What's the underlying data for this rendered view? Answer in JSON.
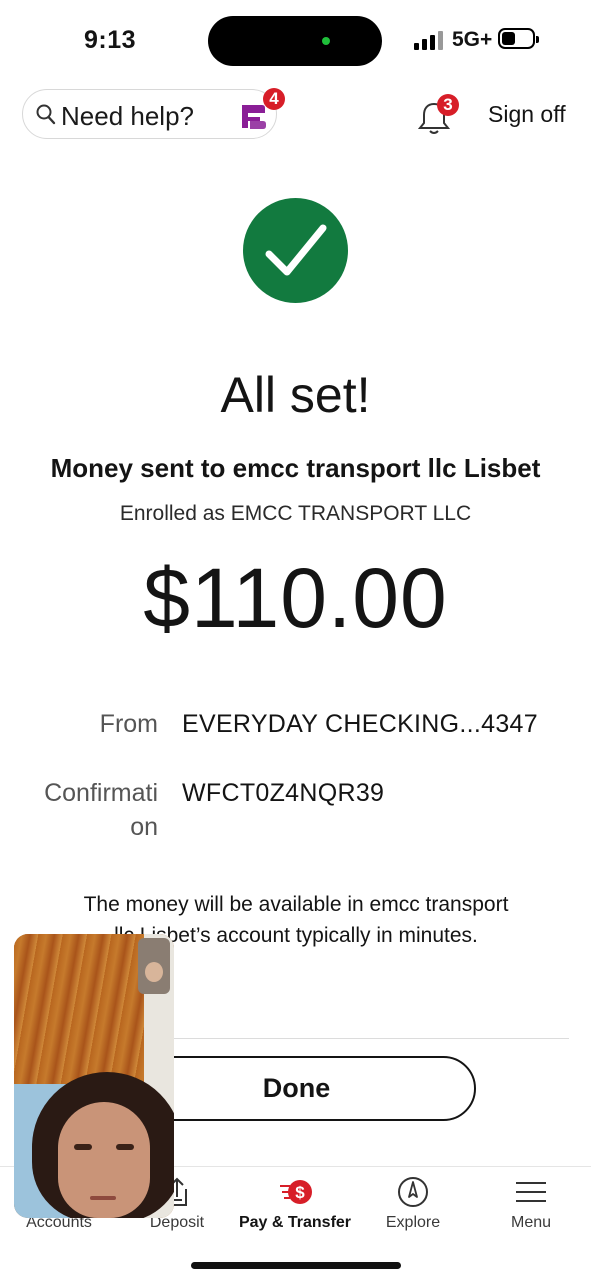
{
  "status_bar": {
    "time": "9:13",
    "network": "5G+"
  },
  "header": {
    "search_placeholder": "Need help?",
    "fargo_badge": "4",
    "notifications_badge": "3",
    "sign_off": "Sign off"
  },
  "confirmation": {
    "title": "All set!",
    "sent_to": "Money sent to emcc transport llc Lisbet",
    "enrolled_as": "Enrolled as EMCC TRANSPORT LLC",
    "amount": "$110.00",
    "from_label": "From",
    "from_value": "EVERYDAY CHECKING...4347",
    "confirmation_label_line1": "Confirmati",
    "confirmation_label_line2": "on",
    "confirmation_value": "WFCT0Z4NQR39",
    "message": "The money will be available in emcc transport llc Lisbet’s account typically in minutes.",
    "done_label": "Done"
  },
  "bottom_nav": {
    "items": [
      {
        "label": "Accounts",
        "icon": "accounts-icon"
      },
      {
        "label": "Deposit",
        "icon": "deposit-icon"
      },
      {
        "label": "Pay & Transfer",
        "icon": "pay-transfer-icon",
        "active": true
      },
      {
        "label": "Explore",
        "icon": "compass-icon"
      },
      {
        "label": "Menu",
        "icon": "hamburger-icon"
      }
    ]
  },
  "colors": {
    "success_green": "#127a3f",
    "brand_red": "#d71e28",
    "fargo_purple": "#8a1e96"
  }
}
